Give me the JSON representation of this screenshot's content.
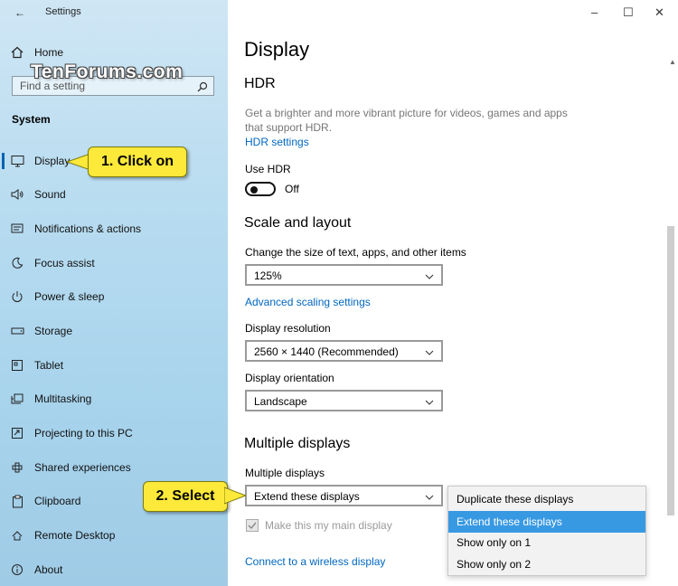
{
  "window": {
    "title": "Settings",
    "controls": {
      "minimize": "–",
      "maximize": "☐",
      "close": "✕"
    }
  },
  "sidebar": {
    "home_label": "Home",
    "search_placeholder": "Find a setting",
    "section_label": "System",
    "items": [
      {
        "label": "Display",
        "icon": "monitor-icon"
      },
      {
        "label": "Sound",
        "icon": "speaker-icon"
      },
      {
        "label": "Notifications & actions",
        "icon": "notification-icon"
      },
      {
        "label": "Focus assist",
        "icon": "moon-icon"
      },
      {
        "label": "Power & sleep",
        "icon": "power-icon"
      },
      {
        "label": "Storage",
        "icon": "storage-icon"
      },
      {
        "label": "Tablet",
        "icon": "tablet-icon"
      },
      {
        "label": "Multitasking",
        "icon": "multitasking-icon"
      },
      {
        "label": "Projecting to this PC",
        "icon": "projector-icon"
      },
      {
        "label": "Shared experiences",
        "icon": "shared-icon"
      },
      {
        "label": "Clipboard",
        "icon": "clipboard-icon"
      },
      {
        "label": "Remote Desktop",
        "icon": "remote-desktop-icon"
      },
      {
        "label": "About",
        "icon": "info-icon"
      }
    ]
  },
  "watermark": "TenForums.com",
  "callouts": {
    "step1": "1. Click on",
    "step2": "2. Select"
  },
  "main": {
    "title": "Display",
    "hdr": {
      "heading": "HDR",
      "description": "Get a brighter and more vibrant picture for videos, games and apps that support HDR.",
      "link": "HDR settings",
      "use_hdr_label": "Use HDR",
      "toggle_state": "Off"
    },
    "scale": {
      "heading": "Scale and layout",
      "size_label": "Change the size of text, apps, and other items",
      "size_value": "125%",
      "advanced_link": "Advanced scaling settings",
      "resolution_label": "Display resolution",
      "resolution_value": "2560 × 1440 (Recommended)",
      "orientation_label": "Display orientation",
      "orientation_value": "Landscape"
    },
    "multi": {
      "heading": "Multiple displays",
      "label": "Multiple displays",
      "value": "Extend these displays",
      "main_display_label": "Make this my main display",
      "wireless_link": "Connect to a wireless display",
      "options": [
        "Duplicate these displays",
        "Extend these displays",
        "Show only on 1",
        "Show only on 2"
      ],
      "selected_index": 1
    }
  }
}
